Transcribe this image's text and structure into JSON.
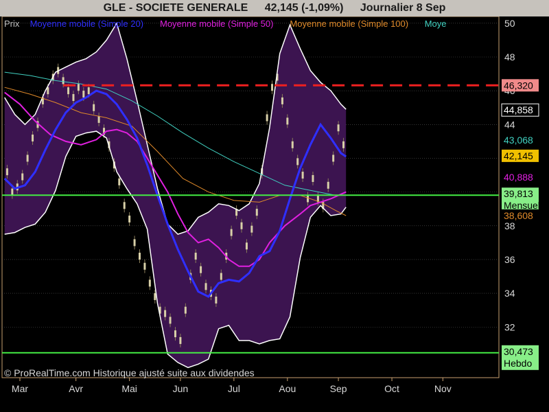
{
  "header": {
    "title": "GLE - SOCIETE GENERALE",
    "quote": "42,145 (-1,09%)",
    "period": "Journalier  8 Sep"
  },
  "legend": [
    {
      "label": "Prix",
      "color": "#c0c0c0"
    },
    {
      "label": "Moyenne mobile (Simple 20)",
      "color": "#2f2fff"
    },
    {
      "label": "Moyenne mobile (Simple 50)",
      "color": "#e020e0"
    },
    {
      "label": "Moyenne mobile (Simple 100)",
      "color": "#e08a2a"
    },
    {
      "label": "Moye",
      "color": "#40d0c0"
    }
  ],
  "copyright": "© ProRealTime.com Historique ajusté suite aux dividendes",
  "colors": {
    "background": "#000000",
    "band_fill": "#3c1450",
    "band_edge": "#ffffff",
    "sma20": "#2f2fff",
    "sma50": "#e020e0",
    "sma100": "#e08a2a",
    "sma200": "#40d0c0",
    "candle": "#d8d0a8",
    "green_line": "#44ee44",
    "red_line": "#ee2020",
    "axis": "#c8a070"
  },
  "chart_data": {
    "type": "line",
    "y_axis": {
      "min": 29.0,
      "max": 50.4,
      "ticks": [
        {
          "value": 50,
          "label": "50"
        },
        {
          "value": 48,
          "label": "48"
        },
        {
          "value": 46,
          "label": "46"
        },
        {
          "value": 44,
          "label": "44"
        },
        {
          "value": 42,
          "label": "42"
        },
        {
          "value": 40,
          "label": "40"
        },
        {
          "value": 38,
          "label": "38"
        },
        {
          "value": 36,
          "label": "36"
        },
        {
          "value": 34,
          "label": "34"
        },
        {
          "value": 32,
          "label": "32"
        }
      ],
      "grid": true
    },
    "x_axis": {
      "labels": [
        "Mar",
        "Avr",
        "Mai",
        "Jun",
        "Jul",
        "Aou",
        "Sep",
        "Oct",
        "Nov"
      ],
      "label_index": [
        6,
        28,
        49,
        69,
        90,
        111,
        131,
        152,
        172
      ],
      "range": [
        -1,
        194
      ]
    },
    "series": [
      {
        "name": "Moyenne mobile (Simple 20)",
        "key": "sma20",
        "x": [
          0,
          4,
          8,
          12,
          16,
          20,
          24,
          28,
          32,
          36,
          40,
          44,
          48,
          52,
          56,
          60,
          64,
          68,
          72,
          76,
          80,
          84,
          88,
          92,
          96,
          100,
          104,
          108,
          112,
          116,
          120,
          124,
          128,
          132,
          134
        ],
        "y": [
          40.8,
          40.2,
          40.4,
          41.2,
          42.5,
          43.7,
          44.7,
          45.3,
          45.6,
          46.0,
          45.8,
          45.2,
          44.3,
          43.2,
          41.6,
          39.8,
          38.1,
          36.6,
          35.3,
          34.1,
          33.8,
          34.6,
          34.8,
          34.7,
          35.2,
          36.2,
          36.5,
          37.7,
          39.6,
          41.4,
          42.8,
          44.0,
          43.2,
          42.3,
          42.1
        ]
      },
      {
        "name": "Moyenne mobile (Simple 50)",
        "key": "sma50",
        "x": [
          0,
          6,
          12,
          18,
          24,
          30,
          36,
          40,
          44,
          48,
          52,
          56,
          60,
          64,
          68,
          72,
          76,
          80,
          84,
          88,
          92,
          96,
          100,
          104,
          110,
          116,
          120,
          124,
          128,
          134
        ],
        "y": [
          45.9,
          45.2,
          44.2,
          43.4,
          43.0,
          42.8,
          43.1,
          43.6,
          43.7,
          43.5,
          43.0,
          42.0,
          41.0,
          40.0,
          38.7,
          37.6,
          37.0,
          37.2,
          36.7,
          36.0,
          35.6,
          35.6,
          36.0,
          37.0,
          38.0,
          38.7,
          39.2,
          39.4,
          39.6,
          40.0
        ]
      },
      {
        "name": "Moyenne mobile (Simple 100)",
        "key": "sma100",
        "x": [
          0,
          10,
          20,
          30,
          40,
          50,
          60,
          70,
          80,
          90,
          100,
          108,
          116,
          124,
          130,
          134
        ],
        "y": [
          46.2,
          45.8,
          45.3,
          44.7,
          44.4,
          43.9,
          42.4,
          40.8,
          40.0,
          39.5,
          39.4,
          39.8,
          39.8,
          39.4,
          38.9,
          38.6
        ]
      },
      {
        "name": "Moye",
        "key": "sma200",
        "x": [
          0,
          10,
          20,
          30,
          40,
          50,
          60,
          70,
          80,
          90,
          100,
          110,
          120,
          130,
          134
        ],
        "y": [
          47.1,
          46.9,
          46.6,
          46.4,
          46.1,
          45.4,
          44.5,
          43.5,
          42.6,
          41.8,
          41.1,
          40.4,
          40.1,
          39.8,
          39.8
        ]
      },
      {
        "name": "Bollinger haute",
        "key": "bb_upper",
        "x": [
          0,
          4,
          8,
          12,
          16,
          20,
          24,
          28,
          32,
          36,
          40,
          44,
          48,
          52,
          56,
          60,
          64,
          68,
          72,
          76,
          80,
          84,
          88,
          92,
          96,
          100,
          104,
          108,
          112,
          116,
          120,
          124,
          128,
          132,
          134
        ],
        "y": [
          45.6,
          44.6,
          44.0,
          44.6,
          46.0,
          47.1,
          47.4,
          47.7,
          47.9,
          48.3,
          49.0,
          50.0,
          47.9,
          45.4,
          42.8,
          40.2,
          38.1,
          37.5,
          37.7,
          38.5,
          38.8,
          39.3,
          39.2,
          38.9,
          39.3,
          40.5,
          43.8,
          48.2,
          49.9,
          48.5,
          47.2,
          46.5,
          46.0,
          45.2,
          44.9
        ]
      },
      {
        "name": "Bollinger basse",
        "key": "bb_lower",
        "x": [
          0,
          4,
          8,
          12,
          16,
          20,
          24,
          28,
          32,
          36,
          40,
          44,
          48,
          52,
          56,
          60,
          64,
          68,
          72,
          76,
          80,
          84,
          88,
          92,
          96,
          100,
          104,
          108,
          112,
          116,
          120,
          124,
          128,
          132,
          134
        ],
        "y": [
          37.5,
          37.6,
          37.9,
          38.1,
          38.8,
          40.1,
          42.1,
          43.3,
          43.5,
          43.6,
          43.2,
          41.2,
          40.2,
          39.3,
          37.8,
          33.4,
          30.4,
          29.9,
          29.6,
          29.8,
          30.1,
          31.9,
          32.1,
          31.2,
          31.2,
          31.0,
          31.2,
          31.3,
          32.6,
          36.1,
          38.5,
          39.2,
          38.6,
          38.7,
          39.1
        ]
      }
    ],
    "candles": {
      "x": [
        1,
        3,
        5,
        7,
        9,
        11,
        13,
        15,
        17,
        19,
        21,
        23,
        25,
        27,
        29,
        31,
        33,
        35,
        37,
        39,
        41,
        43,
        45,
        47,
        49,
        51,
        53,
        55,
        57,
        59,
        61,
        63,
        65,
        67,
        69,
        71,
        73,
        75,
        77,
        79,
        81,
        83,
        85,
        87,
        89,
        91,
        93,
        95,
        97,
        99,
        101,
        103,
        105,
        107,
        109,
        111,
        113,
        115,
        117,
        119,
        121,
        123,
        125,
        127,
        129,
        131,
        133
      ],
      "y": [
        41.2,
        40.0,
        40.3,
        40.9,
        42.0,
        43.2,
        44.0,
        45.4,
        46.0,
        46.8,
        47.2,
        46.6,
        46.0,
        45.6,
        46.2,
        45.8,
        46.0,
        45.0,
        44.3,
        43.6,
        42.8,
        41.6,
        40.6,
        39.2,
        38.4,
        37.0,
        36.2,
        35.6,
        34.6,
        33.8,
        33.0,
        32.8,
        32.4,
        31.6,
        31.2,
        33.0,
        35.0,
        36.2,
        35.4,
        34.4,
        34.0,
        33.6,
        35.0,
        36.2,
        37.6,
        38.8,
        38.0,
        36.8,
        37.8,
        38.8,
        41.2,
        44.4,
        46.2,
        46.8,
        45.4,
        44.2,
        42.8,
        41.8,
        41.0,
        39.6,
        40.8,
        39.6,
        39.2,
        40.4,
        42.0,
        43.8,
        42.8
      ]
    },
    "levels": [
      {
        "name": "resistance",
        "value": 46.32,
        "style": "dashed"
      },
      {
        "name": "mensuel",
        "value": 39.813,
        "style": "solid"
      },
      {
        "name": "hebdo",
        "value": 30.473,
        "style": "solid"
      }
    ],
    "price_tags": [
      {
        "value": 46.32,
        "label": "46,320",
        "bg": "#f08a8a",
        "fg": "#000000",
        "extra": ""
      },
      {
        "value": 44.858,
        "label": "44,858",
        "bg": "#000000",
        "fg": "#ffffff",
        "border": "#ffffff",
        "extra": ""
      },
      {
        "value": 43.068,
        "label": "43,068",
        "bg": "#000000",
        "fg": "#40d0c0",
        "extra": ""
      },
      {
        "value": 42.145,
        "label": "42,145",
        "bg": "#f0c000",
        "fg": "#000000",
        "extra": ""
      },
      {
        "value": 40.888,
        "label": "40,888",
        "bg": "#000000",
        "fg": "#e020e0",
        "extra": ""
      },
      {
        "value": 39.813,
        "label": "39,813",
        "bg": "#88ee88",
        "fg": "#000000",
        "extra": "Mensuel"
      },
      {
        "value": 38.608,
        "label": "38,608",
        "bg": "#000000",
        "fg": "#e08a2a",
        "extra": ""
      },
      {
        "value": 30.473,
        "label": "30,473",
        "bg": "#88ee88",
        "fg": "#000000",
        "extra": "Hebdo"
      }
    ]
  }
}
